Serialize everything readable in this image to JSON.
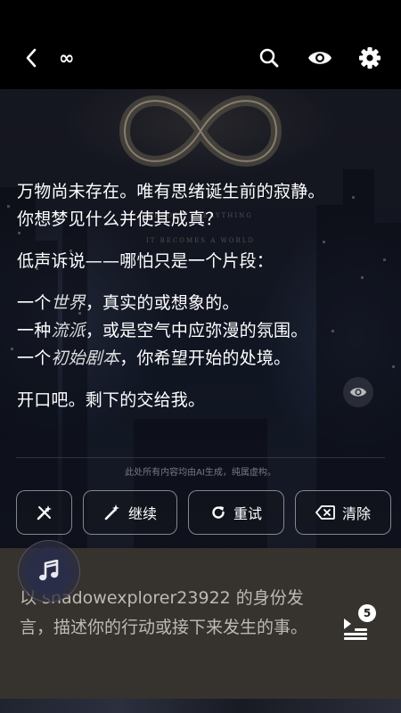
{
  "header": {
    "title": "∞",
    "icons": [
      "back-arrow-icon",
      "search-icon",
      "eye-icon",
      "gear-icon"
    ]
  },
  "art": {
    "caption_line1": "BEFORE EVERYTHING",
    "caption_line2": "IT BECOMES A WORLD"
  },
  "story": {
    "line1": "万物尚未存在。唯有思绪诞生前的寂静。",
    "line2": "你想梦见什么并使其成真？",
    "line3": "低声诉说——哪怕只是一个片段：",
    "item1_pre": "一个",
    "item1_em": "世界",
    "item1_post": "，真实的或想象的。",
    "item2_pre": "一种",
    "item2_em": "流派",
    "item2_post": "，或是空气中应弥漫的氛围。",
    "item3_pre": "一个",
    "item3_em": "初始剧本",
    "item3_post": "，你希望开始的处境。",
    "line4": "开口吧。剩下的交给我。"
  },
  "disclaimer": "此处所有内容均由AI生成，纯属虚构。",
  "actions": {
    "continue_label": "继续",
    "retry_label": "重试",
    "clear_label": "清除"
  },
  "composer": {
    "placeholder": "以 shadowexplorer23922 的身份发言，描述你的行动或接下来发生的事。",
    "queue_count": "5"
  },
  "colors": {
    "topbar": "#000000",
    "composer_bg": "#36332f",
    "placeholder_text": "#bdbab4",
    "music_button": "#2a2d48"
  }
}
